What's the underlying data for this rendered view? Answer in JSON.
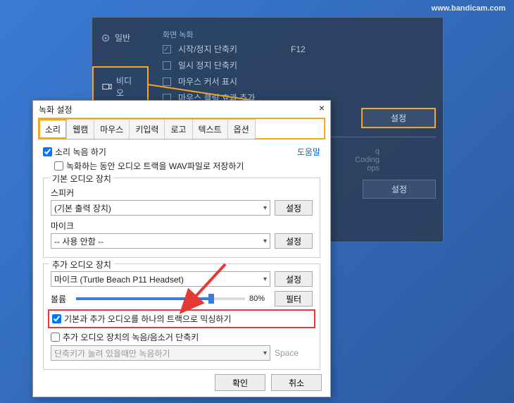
{
  "watermark": "www.bandicam.com",
  "bg": {
    "side": {
      "general": "일반",
      "video": "비디오"
    },
    "top_label": "화면 녹화",
    "rec_hotkey": "시작/정지 단축키",
    "rec_hotkey_val": "F12",
    "pause_hotkey": "일시 정지 단축키",
    "cursor": "마우스 커서 표시",
    "cursor_effect": "마우스 클릭 효과 추가",
    "settings_btn": "설정",
    "codec1": "q",
    "codec2": "Coding",
    "codec3": "ops",
    "settings_btn2": "설정"
  },
  "dialog": {
    "title": "녹화 설정",
    "tabs": [
      "소리",
      "웹캠",
      "마우스",
      "키입력",
      "로고",
      "텍스트",
      "옵션"
    ],
    "help": "도움말",
    "record_sound": "소리 녹음 하기",
    "save_wav": "녹화하는 동안 오디오 트랙을 WAV파일로 저장하기",
    "group1": "기본 오디오 장치",
    "speaker_label": "스피커",
    "speaker_val": "(기본 출력 장치)",
    "mic_label": "마이크",
    "mic_val": "-- 사용 안함 --",
    "settings": "설정",
    "group2": "추가 오디오 장치",
    "sec_device": "마이크 (Turtle Beach P11 Headset)",
    "volume_label": "볼륨",
    "volume_pct": "80%",
    "filter": "필터",
    "mix_check": "기본과 추가 오디오를 하나의 트랙으로 믹싱하기",
    "mute_check": "추가 오디오 장치의 녹음/음소거 단축키",
    "mute_hint": "단축키가 눌려 있을때만 녹음하기",
    "mute_key": "Space",
    "ok": "확인",
    "cancel": "취소"
  }
}
